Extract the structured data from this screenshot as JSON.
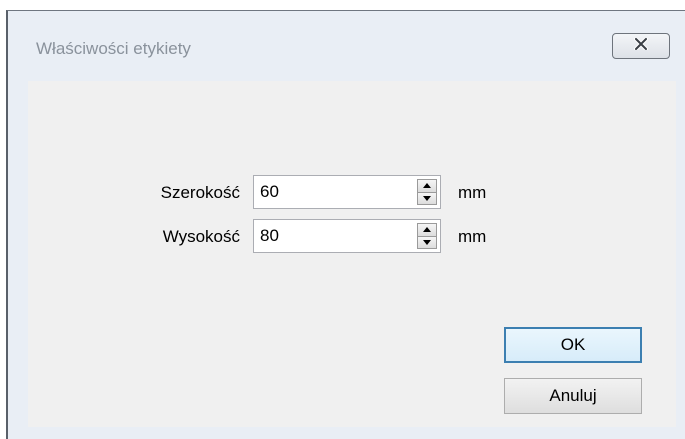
{
  "window": {
    "title": "Właściwości etykiety"
  },
  "titlebar": {
    "close_icon": "close-x-icon"
  },
  "form": {
    "width_label": "Szerokość",
    "width_value": "60",
    "width_unit": "mm",
    "height_label": "Wysokość",
    "height_value": "80",
    "height_unit": "mm"
  },
  "buttons": {
    "ok_label": "OK",
    "cancel_label": "Anuluj"
  },
  "colors": {
    "title_text": "#8a929c",
    "dialog_bg": "#f0f0f0",
    "frame_bg": "#e9eef5",
    "default_button_border": "#3c7fb1"
  }
}
